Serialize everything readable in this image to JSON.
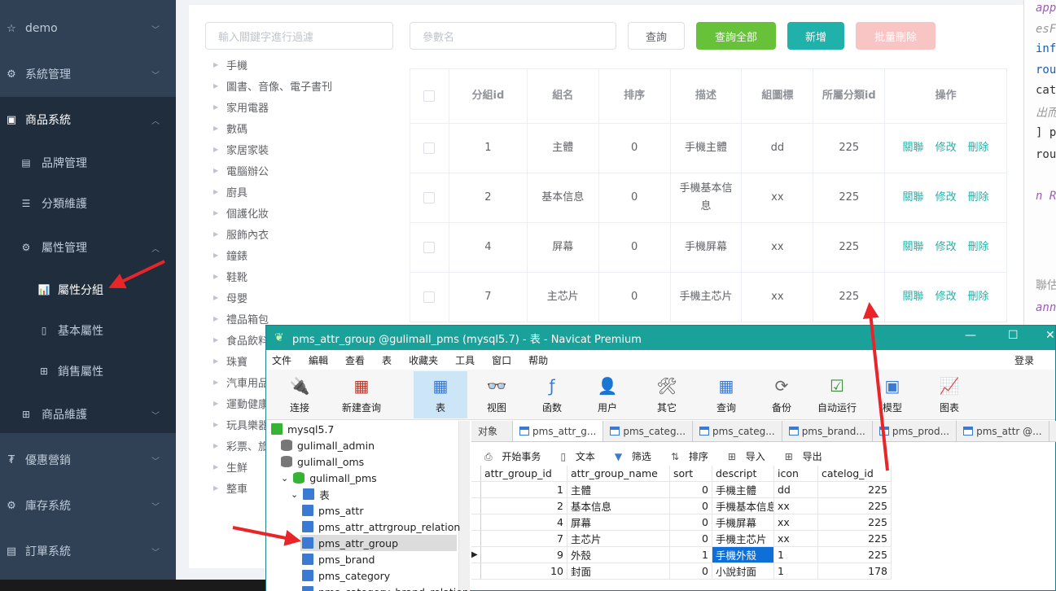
{
  "sidebar": {
    "items": [
      {
        "label": "demo",
        "icon": "star-icon"
      },
      {
        "label": "系統管理",
        "icon": "gear-icon"
      },
      {
        "label": "商品系統",
        "icon": "grid-icon"
      },
      {
        "label": "品牌管理",
        "icon": "image-icon"
      },
      {
        "label": "分類維護",
        "icon": "list-icon"
      },
      {
        "label": "屬性管理",
        "icon": "gear-icon"
      },
      {
        "label": "屬性分組",
        "icon": "bar-chart-icon"
      },
      {
        "label": "基本屬性",
        "icon": "document-icon"
      },
      {
        "label": "銷售屬性",
        "icon": "grid-icon"
      },
      {
        "label": "商品維護",
        "icon": "grid-icon"
      },
      {
        "label": "優惠營銷",
        "icon": "tag-icon"
      },
      {
        "label": "庫存系統",
        "icon": "gear-icon"
      },
      {
        "label": "訂單系統",
        "icon": "list-icon"
      }
    ]
  },
  "toolbar": {
    "filter_placeholder": "輸入關鍵字進行過濾",
    "param_placeholder": "參數名",
    "query_label": "查詢",
    "query_all_label": "查詢全部",
    "add_label": "新增",
    "batch_delete_label": "批量刪除"
  },
  "tree": [
    "手機",
    "圖書、音像、電子書刊",
    "家用電器",
    "數碼",
    "家居家裝",
    "電腦辦公",
    "廚具",
    "個護化妝",
    "服飾內衣",
    "鐘錶",
    "鞋靴",
    "母嬰",
    "禮品箱包",
    "食品飲料",
    "珠寶",
    "汽車用品",
    "運動健康",
    "玩具樂器",
    "彩票、旅行",
    "生鮮",
    "整車"
  ],
  "grid": {
    "headers": [
      "分組id",
      "組名",
      "排序",
      "描述",
      "組圖標",
      "所屬分類id",
      "操作"
    ],
    "rows": [
      {
        "id": "1",
        "name": "主體",
        "sort": "0",
        "desc": "手機主體",
        "icon": "dd",
        "cat": "225"
      },
      {
        "id": "2",
        "name": "基本信息",
        "sort": "0",
        "desc": "手機基本信息",
        "icon": "xx",
        "cat": "225"
      },
      {
        "id": "4",
        "name": "屏幕",
        "sort": "0",
        "desc": "手機屏幕",
        "icon": "xx",
        "cat": "225"
      },
      {
        "id": "7",
        "name": "主芯片",
        "sort": "0",
        "desc": "手機主芯片",
        "icon": "xx",
        "cat": "225"
      }
    ],
    "actions": [
      "關聯",
      "修改",
      "刪除"
    ]
  },
  "navicat": {
    "title": "pms_attr_group @gulimall_pms (mysql5.7) - 表 - Navicat Premium",
    "menu": [
      "文件",
      "編輯",
      "查看",
      "表",
      "收藏夹",
      "工具",
      "窗口",
      "帮助"
    ],
    "login": "登录",
    "tools": [
      {
        "label": "连接",
        "icon": "plug-icon"
      },
      {
        "label": "新建查询",
        "icon": "table-add-icon"
      },
      {
        "label": "表",
        "icon": "table-icon"
      },
      {
        "label": "视图",
        "icon": "glasses-icon"
      },
      {
        "label": "函数",
        "icon": "function-icon"
      },
      {
        "label": "用户",
        "icon": "user-icon"
      },
      {
        "label": "其它",
        "icon": "tools-icon"
      },
      {
        "label": "查询",
        "icon": "query-icon"
      },
      {
        "label": "备份",
        "icon": "backup-icon"
      },
      {
        "label": "自动运行",
        "icon": "checklist-icon"
      },
      {
        "label": "模型",
        "icon": "model-icon"
      },
      {
        "label": "图表",
        "icon": "chart-icon"
      }
    ],
    "connections": [
      "mysql5.7",
      "gulimall_admin",
      "gulimall_oms",
      "gulimall_pms",
      "表",
      "pms_attr",
      "pms_attr_attrgroup_relation",
      "pms_attr_group",
      "pms_brand",
      "pms_category",
      "pms_category_brand_relation"
    ],
    "tabs": [
      "对象",
      "pms_attr_g...",
      "pms_categ...",
      "pms_categ...",
      "pms_brand...",
      "pms_prod...",
      "pms_attr @..."
    ],
    "subtoolbar": [
      "开始事务",
      "文本",
      "筛选",
      "排序",
      "导入",
      "导出"
    ],
    "columns": [
      "attr_group_id",
      "attr_group_name",
      "sort",
      "descript",
      "icon",
      "catelog_id"
    ],
    "rows": [
      {
        "id": "1",
        "name": "主體",
        "sort": "0",
        "desc": "手機主體",
        "icon": "dd",
        "cat": "225"
      },
      {
        "id": "2",
        "name": "基本信息",
        "sort": "0",
        "desc": "手機基本信息",
        "icon": "xx",
        "cat": "225"
      },
      {
        "id": "4",
        "name": "屏幕",
        "sort": "0",
        "desc": "手機屏幕",
        "icon": "xx",
        "cat": "225"
      },
      {
        "id": "7",
        "name": "主芯片",
        "sort": "0",
        "desc": "手機主芯片",
        "icon": "xx",
        "cat": "225"
      },
      {
        "id": "9",
        "name": "外殼",
        "sort": "1",
        "desc": "手機外殼",
        "icon": "1",
        "cat": "225"
      },
      {
        "id": "10",
        "name": "封面",
        "sort": "0",
        "desc": "小說封面",
        "icon": "1",
        "cat": "178"
      }
    ]
  },
  "code_fragment": [
    "app",
    "esF",
    "inf",
    "rou",
    "cat",
    "出而",
    "] p",
    "rou",
    "n R",
    "聯估",
    "ann"
  ]
}
